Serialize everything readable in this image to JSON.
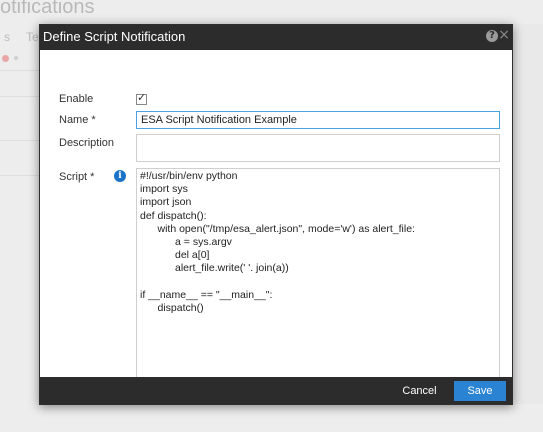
{
  "background": {
    "title": "otifications",
    "tab1": "s",
    "tab2": "Te"
  },
  "dialog": {
    "title": "Define Script Notification",
    "help_icon": "?",
    "close_icon": "×",
    "fields": {
      "enable_label": "Enable",
      "enable_checked": true,
      "name_label": "Name *",
      "name_value": "ESA Script Notification Example",
      "description_label": "Description",
      "description_value": "",
      "script_label": "Script *",
      "script_info_icon": "i",
      "script_lines": [
        "#!/usr/bin/env python",
        "import sys",
        "import json",
        "def dispatch():",
        "      with open(\"/tmp/esa_alert.json\", mode='w') as alert_file:",
        "            a = sys.argv",
        "            del a[0]",
        "            alert_file.write(' '. join(a))",
        "",
        "if __name__ == \"__main__\":",
        "      dispatch()"
      ]
    },
    "buttons": {
      "cancel": "Cancel",
      "save": "Save"
    },
    "colors": {
      "header_bg": "#2c2c2c",
      "primary_button": "#2a84d3",
      "info_icon": "#1a73c9",
      "focus_border": "#4aa3df"
    }
  }
}
